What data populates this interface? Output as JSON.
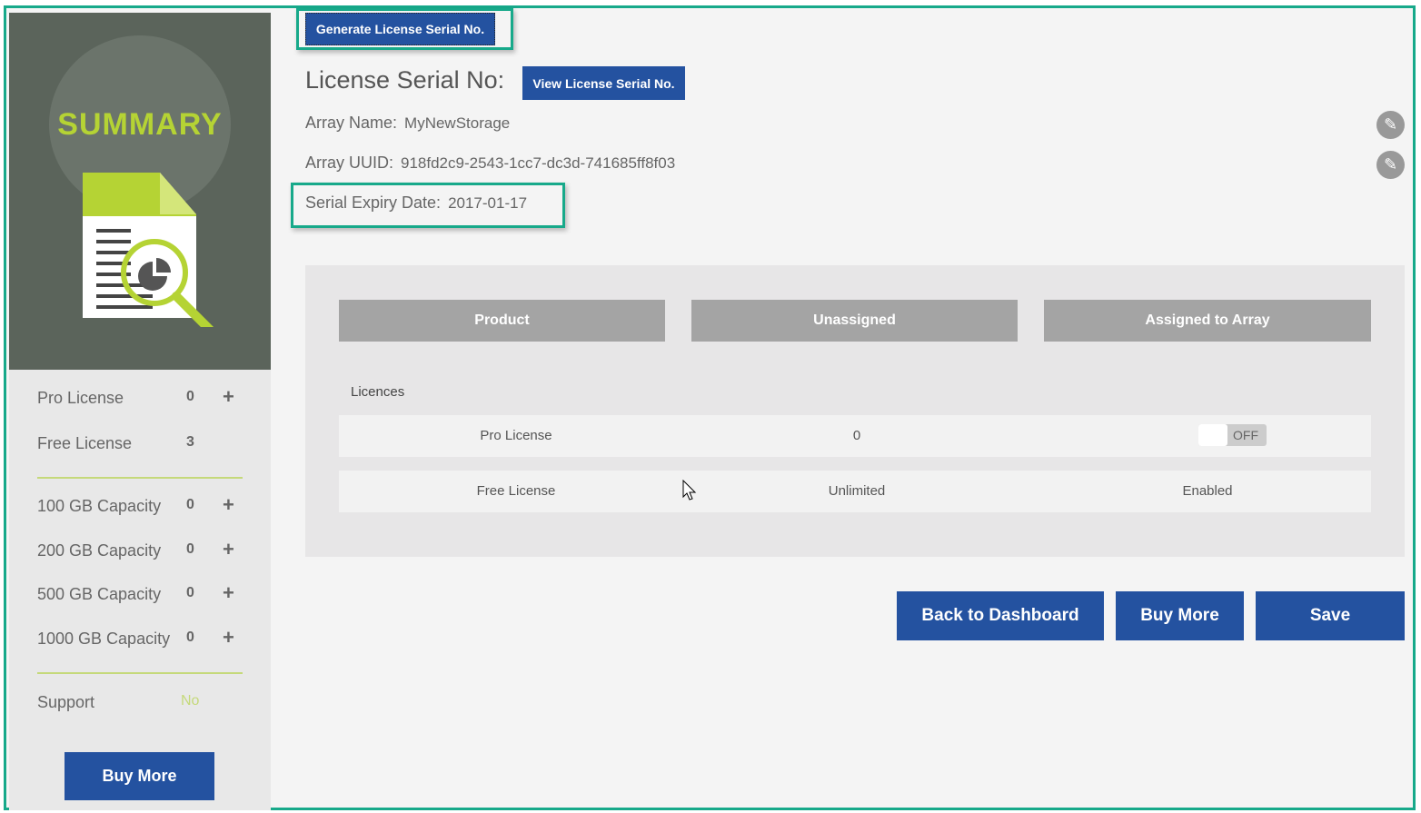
{
  "sidebar": {
    "title": "SUMMARY",
    "items": [
      {
        "label": "Pro License",
        "value": "0",
        "plus": "+"
      },
      {
        "label": "Free License",
        "value": "3"
      },
      {
        "label": "100 GB Capacity",
        "value": "0",
        "plus": "+"
      },
      {
        "label": "200 GB Capacity",
        "value": "0",
        "plus": "+"
      },
      {
        "label": "500 GB Capacity",
        "value": "0",
        "plus": "+"
      },
      {
        "label": "1000 GB Capacity",
        "value": "0",
        "plus": "+"
      }
    ],
    "support": {
      "label": "Support",
      "value": "No"
    },
    "buy_more": "Buy More"
  },
  "main": {
    "generate_button": "Generate License Serial No.",
    "serial_label": "License Serial No:",
    "view_button": "View License Serial No.",
    "array_name_label": "Array Name:",
    "array_name": "MyNewStorage",
    "uuid_label": "Array UUID:",
    "uuid": "918fd2c9-2543-1cc7-dc3d-741685ff8f03",
    "expiry_label": "Serial Expiry Date:",
    "expiry": "2017-01-17",
    "table": {
      "headers": [
        "Product",
        "Unassigned",
        "Assigned to Array"
      ],
      "section": "Licences",
      "rows": [
        {
          "product": "Pro License",
          "unassigned": "0",
          "assigned": "OFF"
        },
        {
          "product": "Free License",
          "unassigned": "Unlimited",
          "assigned": "Enabled"
        }
      ]
    },
    "back_button": "Back to Dashboard",
    "buy_more_button": "Buy More",
    "save_button": "Save"
  }
}
